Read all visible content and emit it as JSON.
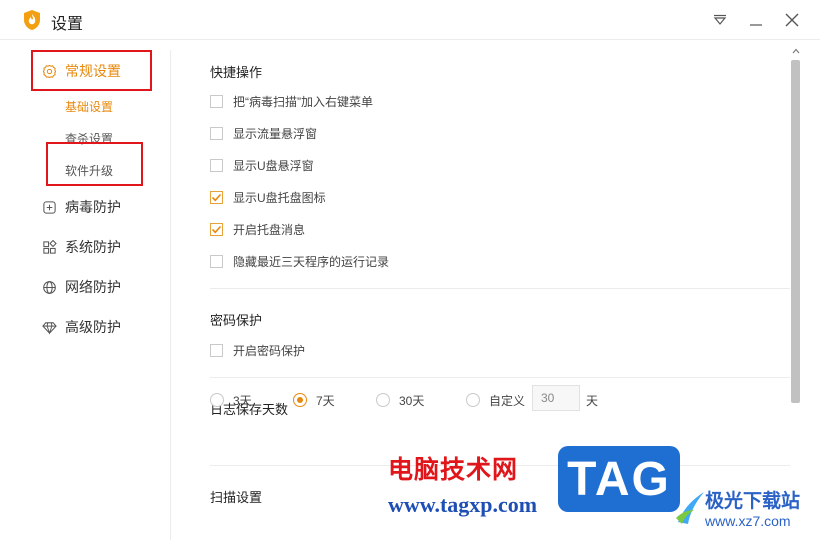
{
  "window": {
    "title": "设置",
    "brand_color": "#e8890e",
    "controls": [
      "dropdown-icon",
      "minimize-icon",
      "close-icon"
    ]
  },
  "sidebar": {
    "items": [
      {
        "label": "常规设置",
        "icon": "gear-icon",
        "active": true
      },
      {
        "label": "病毒防护",
        "icon": "plus-square-icon",
        "active": false
      },
      {
        "label": "系统防护",
        "icon": "blocks-icon",
        "active": false
      },
      {
        "label": "网络防护",
        "icon": "globe-icon",
        "active": false
      },
      {
        "label": "高级防护",
        "icon": "diamond-icon",
        "active": false
      }
    ],
    "sub_items": [
      {
        "label": "基础设置",
        "active": true
      },
      {
        "label": "查杀设置",
        "active": false
      },
      {
        "label": "软件升级",
        "active": false
      }
    ]
  },
  "main": {
    "quick_actions": {
      "title": "快捷操作",
      "options": [
        {
          "label": "把“病毒扫描”加入右键菜单",
          "checked": false
        },
        {
          "label": "显示流量悬浮窗",
          "checked": false
        },
        {
          "label": "显示U盘悬浮窗",
          "checked": false
        },
        {
          "label": "显示U盘托盘图标",
          "checked": true
        },
        {
          "label": "开启托盘消息",
          "checked": true
        },
        {
          "label": "隐藏最近三天程序的运行记录",
          "checked": false
        }
      ]
    },
    "password": {
      "title": "密码保护",
      "options": [
        {
          "label": "开启密码保护",
          "checked": false
        }
      ]
    },
    "log_days": {
      "title": "日志保存天数",
      "options": [
        {
          "label": "3天",
          "selected": false
        },
        {
          "label": "7天",
          "selected": true
        },
        {
          "label": "30天",
          "selected": false
        },
        {
          "label": "自定义",
          "selected": false
        }
      ],
      "custom_value": "30",
      "unit": "天"
    },
    "scan": {
      "title": "扫描设置"
    }
  },
  "watermark": {
    "site_name": "电脑技术网",
    "site_url": "www.tagxp.com",
    "tag": "TAG",
    "brand2": "极光下载站",
    "brand2_url": "www.xz7.com"
  }
}
